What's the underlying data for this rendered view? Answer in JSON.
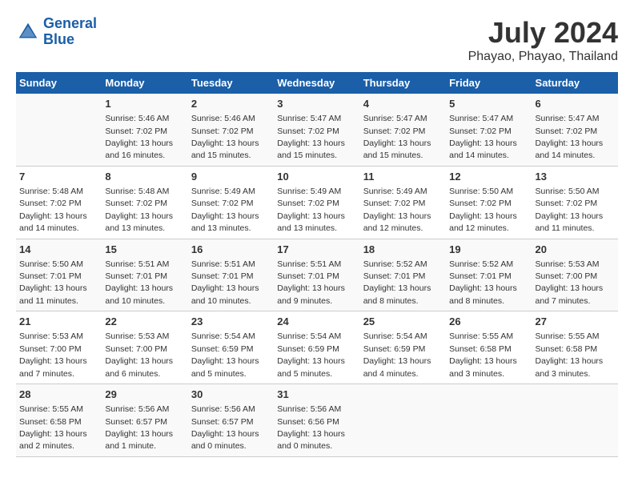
{
  "logo": {
    "line1": "General",
    "line2": "Blue"
  },
  "title": "July 2024",
  "subtitle": "Phayao, Phayao, Thailand",
  "headers": [
    "Sunday",
    "Monday",
    "Tuesday",
    "Wednesday",
    "Thursday",
    "Friday",
    "Saturday"
  ],
  "weeks": [
    [
      null,
      {
        "num": "1",
        "sunrise": "5:46 AM",
        "sunset": "7:02 PM",
        "daylight": "13 hours and 16 minutes."
      },
      {
        "num": "2",
        "sunrise": "5:46 AM",
        "sunset": "7:02 PM",
        "daylight": "13 hours and 15 minutes."
      },
      {
        "num": "3",
        "sunrise": "5:47 AM",
        "sunset": "7:02 PM",
        "daylight": "13 hours and 15 minutes."
      },
      {
        "num": "4",
        "sunrise": "5:47 AM",
        "sunset": "7:02 PM",
        "daylight": "13 hours and 15 minutes."
      },
      {
        "num": "5",
        "sunrise": "5:47 AM",
        "sunset": "7:02 PM",
        "daylight": "13 hours and 14 minutes."
      },
      {
        "num": "6",
        "sunrise": "5:47 AM",
        "sunset": "7:02 PM",
        "daylight": "13 hours and 14 minutes."
      }
    ],
    [
      {
        "num": "7",
        "sunrise": "5:48 AM",
        "sunset": "7:02 PM",
        "daylight": "13 hours and 14 minutes."
      },
      {
        "num": "8",
        "sunrise": "5:48 AM",
        "sunset": "7:02 PM",
        "daylight": "13 hours and 13 minutes."
      },
      {
        "num": "9",
        "sunrise": "5:49 AM",
        "sunset": "7:02 PM",
        "daylight": "13 hours and 13 minutes."
      },
      {
        "num": "10",
        "sunrise": "5:49 AM",
        "sunset": "7:02 PM",
        "daylight": "13 hours and 13 minutes."
      },
      {
        "num": "11",
        "sunrise": "5:49 AM",
        "sunset": "7:02 PM",
        "daylight": "13 hours and 12 minutes."
      },
      {
        "num": "12",
        "sunrise": "5:50 AM",
        "sunset": "7:02 PM",
        "daylight": "13 hours and 12 minutes."
      },
      {
        "num": "13",
        "sunrise": "5:50 AM",
        "sunset": "7:02 PM",
        "daylight": "13 hours and 11 minutes."
      }
    ],
    [
      {
        "num": "14",
        "sunrise": "5:50 AM",
        "sunset": "7:01 PM",
        "daylight": "13 hours and 11 minutes."
      },
      {
        "num": "15",
        "sunrise": "5:51 AM",
        "sunset": "7:01 PM",
        "daylight": "13 hours and 10 minutes."
      },
      {
        "num": "16",
        "sunrise": "5:51 AM",
        "sunset": "7:01 PM",
        "daylight": "13 hours and 10 minutes."
      },
      {
        "num": "17",
        "sunrise": "5:51 AM",
        "sunset": "7:01 PM",
        "daylight": "13 hours and 9 minutes."
      },
      {
        "num": "18",
        "sunrise": "5:52 AM",
        "sunset": "7:01 PM",
        "daylight": "13 hours and 8 minutes."
      },
      {
        "num": "19",
        "sunrise": "5:52 AM",
        "sunset": "7:01 PM",
        "daylight": "13 hours and 8 minutes."
      },
      {
        "num": "20",
        "sunrise": "5:53 AM",
        "sunset": "7:00 PM",
        "daylight": "13 hours and 7 minutes."
      }
    ],
    [
      {
        "num": "21",
        "sunrise": "5:53 AM",
        "sunset": "7:00 PM",
        "daylight": "13 hours and 7 minutes."
      },
      {
        "num": "22",
        "sunrise": "5:53 AM",
        "sunset": "7:00 PM",
        "daylight": "13 hours and 6 minutes."
      },
      {
        "num": "23",
        "sunrise": "5:54 AM",
        "sunset": "6:59 PM",
        "daylight": "13 hours and 5 minutes."
      },
      {
        "num": "24",
        "sunrise": "5:54 AM",
        "sunset": "6:59 PM",
        "daylight": "13 hours and 5 minutes."
      },
      {
        "num": "25",
        "sunrise": "5:54 AM",
        "sunset": "6:59 PM",
        "daylight": "13 hours and 4 minutes."
      },
      {
        "num": "26",
        "sunrise": "5:55 AM",
        "sunset": "6:58 PM",
        "daylight": "13 hours and 3 minutes."
      },
      {
        "num": "27",
        "sunrise": "5:55 AM",
        "sunset": "6:58 PM",
        "daylight": "13 hours and 3 minutes."
      }
    ],
    [
      {
        "num": "28",
        "sunrise": "5:55 AM",
        "sunset": "6:58 PM",
        "daylight": "13 hours and 2 minutes."
      },
      {
        "num": "29",
        "sunrise": "5:56 AM",
        "sunset": "6:57 PM",
        "daylight": "13 hours and 1 minute."
      },
      {
        "num": "30",
        "sunrise": "5:56 AM",
        "sunset": "6:57 PM",
        "daylight": "13 hours and 0 minutes."
      },
      {
        "num": "31",
        "sunrise": "5:56 AM",
        "sunset": "6:56 PM",
        "daylight": "13 hours and 0 minutes."
      },
      null,
      null,
      null
    ]
  ]
}
